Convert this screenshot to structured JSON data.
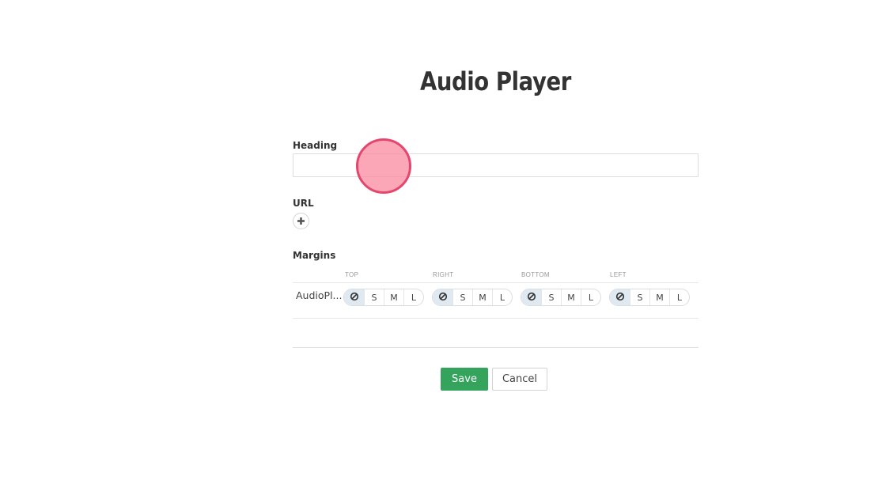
{
  "page": {
    "title": "Audio Player"
  },
  "form": {
    "heading": {
      "label": "Heading",
      "value": "",
      "placeholder": ""
    },
    "url": {
      "label": "URL",
      "add_icon": "plus-icon"
    },
    "margins": {
      "label": "Margins",
      "columns": [
        "TOP",
        "RIGHT",
        "BOTTOM",
        "LEFT"
      ],
      "row_name": "AudioPl...",
      "options": [
        "none-icon",
        "S",
        "M",
        "L"
      ],
      "selected": [
        "none",
        "none",
        "none",
        "none"
      ]
    }
  },
  "actions": {
    "save_label": "Save",
    "cancel_label": "Cancel"
  },
  "colors": {
    "save_button": "#34a35c",
    "selected_segment": "#dfe9f2",
    "cursor_highlight": "#e5466e"
  }
}
